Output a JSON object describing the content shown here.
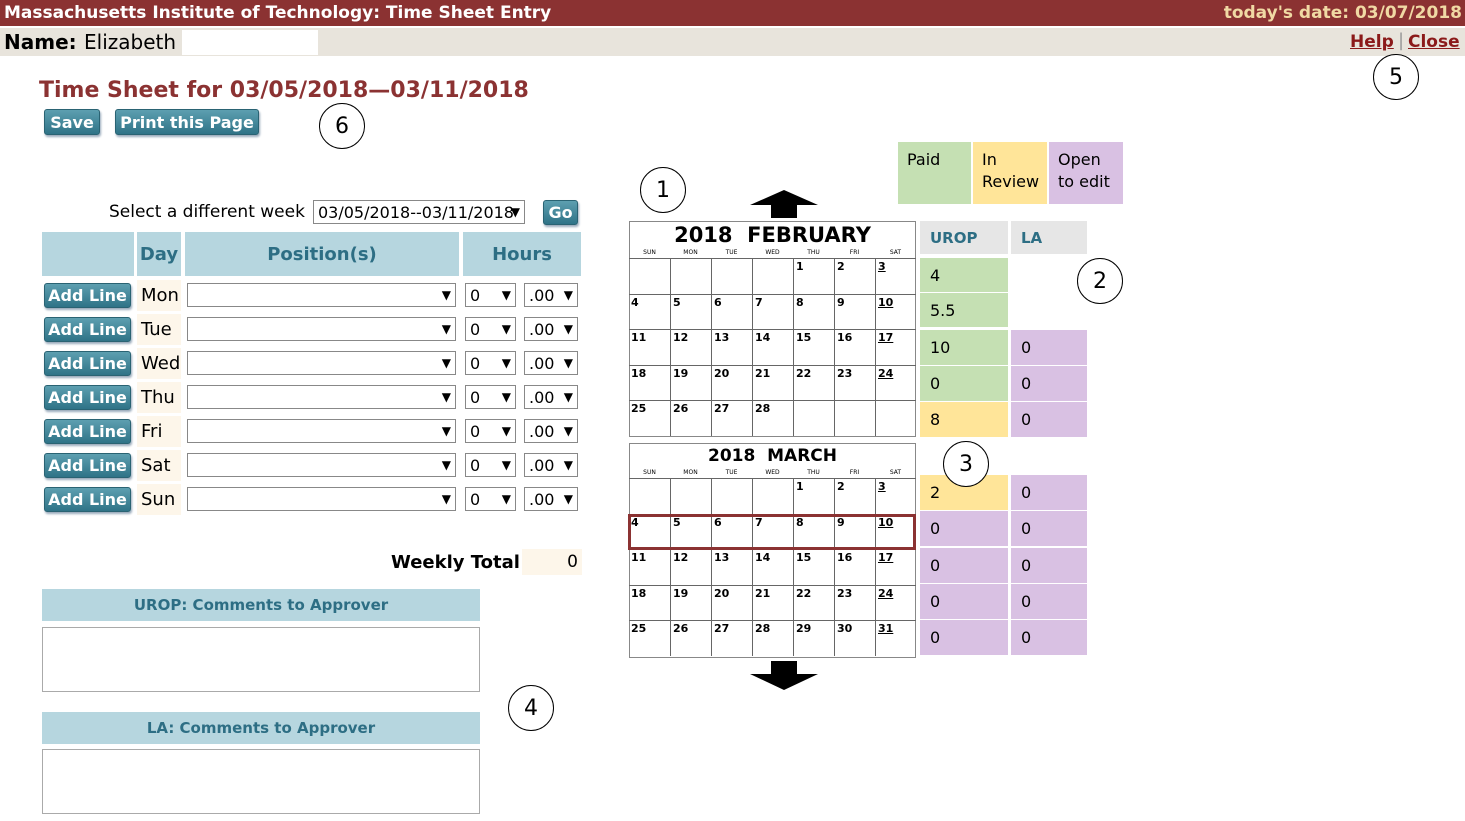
{
  "header": {
    "title": "Massachusetts Institute of Technology: Time Sheet Entry",
    "today": "today's date: 03/07/2018",
    "name_label": "Name:",
    "name_value": "Elizabeth",
    "help_label": "Help",
    "separator": "|",
    "close_label": "Close"
  },
  "sheet": {
    "title": "Time Sheet for 03/05/2018—03/11/2018",
    "save_label": "Save",
    "print_label": "Print this Page"
  },
  "week_select": {
    "label": "Select a different week",
    "value": "03/05/2018--03/11/2018",
    "go_label": "Go"
  },
  "table": {
    "headers": [
      "Day",
      "Position(s)",
      "Hours"
    ],
    "add_line_label": "Add Line",
    "rows": [
      {
        "day": "Mon",
        "position": "",
        "hours": "0",
        "fraction": ".00"
      },
      {
        "day": "Tue",
        "position": "",
        "hours": "0",
        "fraction": ".00"
      },
      {
        "day": "Wed",
        "position": "",
        "hours": "0",
        "fraction": ".00"
      },
      {
        "day": "Thu",
        "position": "",
        "hours": "0",
        "fraction": ".00"
      },
      {
        "day": "Fri",
        "position": "",
        "hours": "0",
        "fraction": ".00"
      },
      {
        "day": "Sat",
        "position": "",
        "hours": "0",
        "fraction": ".00"
      },
      {
        "day": "Sun",
        "position": "",
        "hours": "0",
        "fraction": ".00"
      }
    ],
    "weekly_total_label": "Weekly Total",
    "weekly_total_value": "0"
  },
  "comments": {
    "urop_label": "UROP: Comments to Approver",
    "la_label": "LA: Comments to Approver"
  },
  "legend": {
    "paid": "Paid",
    "review_line1": "In",
    "review_line2": "Review",
    "open_line1": "Open",
    "open_line2": "to edit"
  },
  "status_headers": {
    "urop": "UROP",
    "la": "LA"
  },
  "calendars": [
    {
      "title": "2018  FEBRUARY",
      "dow": [
        "SUN",
        "MON",
        "TUE",
        "WED",
        "THU",
        "FRI",
        "SAT"
      ],
      "weeks": [
        [
          "",
          "",
          "",
          "",
          "1",
          "2",
          "3"
        ],
        [
          "4",
          "5",
          "6",
          "7",
          "8",
          "9",
          "10"
        ],
        [
          "11",
          "12",
          "13",
          "14",
          "15",
          "16",
          "17"
        ],
        [
          "18",
          "19",
          "20",
          "21",
          "22",
          "23",
          "24"
        ],
        [
          "25",
          "26",
          "27",
          "28",
          "",
          "",
          ""
        ]
      ]
    },
    {
      "title": "2018  MARCH",
      "dow": [
        "SUN",
        "MON",
        "TUE",
        "WED",
        "THU",
        "FRI",
        "SAT"
      ],
      "weeks": [
        [
          "",
          "",
          "",
          "",
          "1",
          "2",
          "3"
        ],
        [
          "4",
          "5",
          "6",
          "7",
          "8",
          "9",
          "10"
        ],
        [
          "11",
          "12",
          "13",
          "14",
          "15",
          "16",
          "17"
        ],
        [
          "18",
          "19",
          "20",
          "21",
          "22",
          "23",
          "24"
        ],
        [
          "25",
          "26",
          "27",
          "28",
          "29",
          "30",
          "31"
        ]
      ]
    }
  ],
  "status": {
    "february": [
      {
        "urop": "4",
        "urop_state": "paid",
        "la": "",
        "la_state": "none"
      },
      {
        "urop": "5.5",
        "urop_state": "paid",
        "la": "",
        "la_state": "none"
      },
      {
        "urop": "10",
        "urop_state": "paid",
        "la": "0",
        "la_state": "open"
      },
      {
        "urop": "0",
        "urop_state": "paid",
        "la": "0",
        "la_state": "open"
      },
      {
        "urop": "8",
        "urop_state": "review",
        "la": "0",
        "la_state": "open"
      }
    ],
    "march": [
      {
        "urop": "2",
        "urop_state": "review",
        "la": "0",
        "la_state": "open"
      },
      {
        "urop": "0",
        "urop_state": "open",
        "la": "0",
        "la_state": "open"
      },
      {
        "urop": "0",
        "urop_state": "open",
        "la": "0",
        "la_state": "open"
      },
      {
        "urop": "0",
        "urop_state": "open",
        "la": "0",
        "la_state": "open"
      },
      {
        "urop": "0",
        "urop_state": "open",
        "la": "0",
        "la_state": "open"
      }
    ]
  },
  "markers": [
    "1",
    "2",
    "3",
    "4",
    "5",
    "6"
  ],
  "colors": {
    "brand": "#8b3232",
    "paid": "#c5e0b3",
    "review": "#ffe599",
    "open": "#d9c1e3",
    "header_blue": "#b6d6df"
  }
}
